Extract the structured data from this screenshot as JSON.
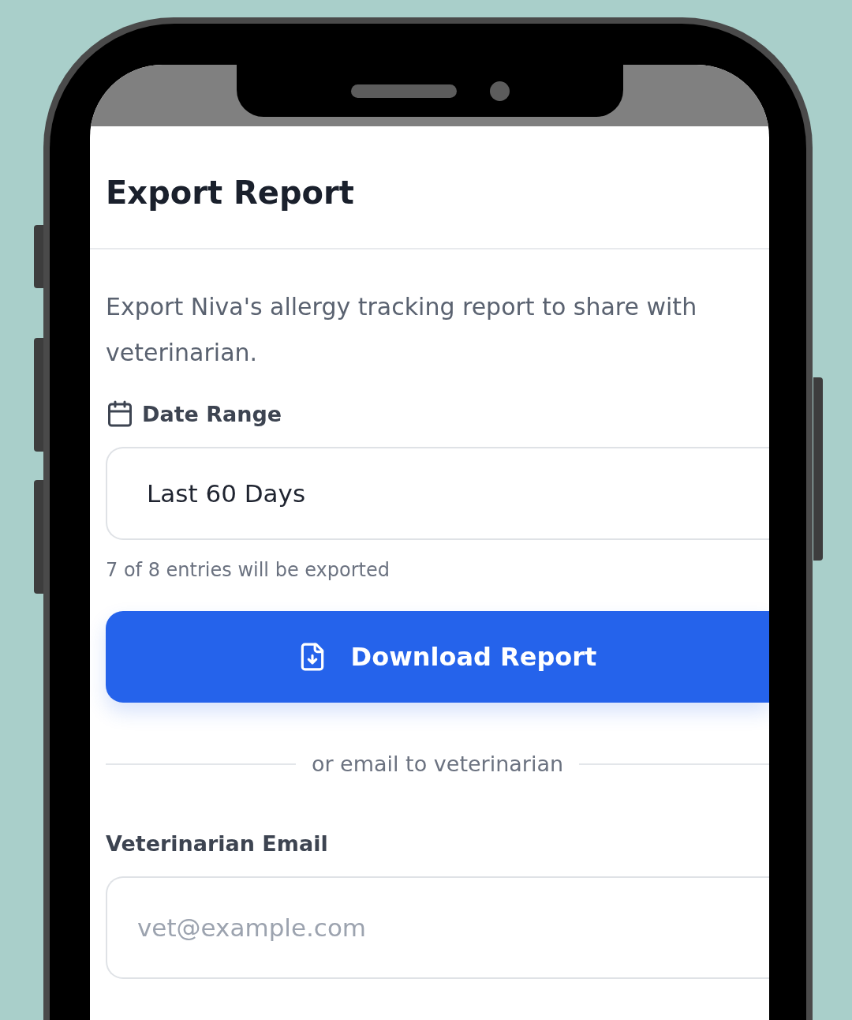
{
  "dialog": {
    "title": "Export Report",
    "description": "Export Niva's allergy tracking report to share with veterinarian.",
    "date_range": {
      "label": "Date Range",
      "value": "Last 60 Days",
      "helper": "7 of 8 entries will be exported"
    },
    "download_button": {
      "label": "Download Report"
    },
    "separator": {
      "text": "or email to veterinarian"
    },
    "email": {
      "label": "Veterinarian Email",
      "placeholder": "vet@example.com"
    }
  }
}
